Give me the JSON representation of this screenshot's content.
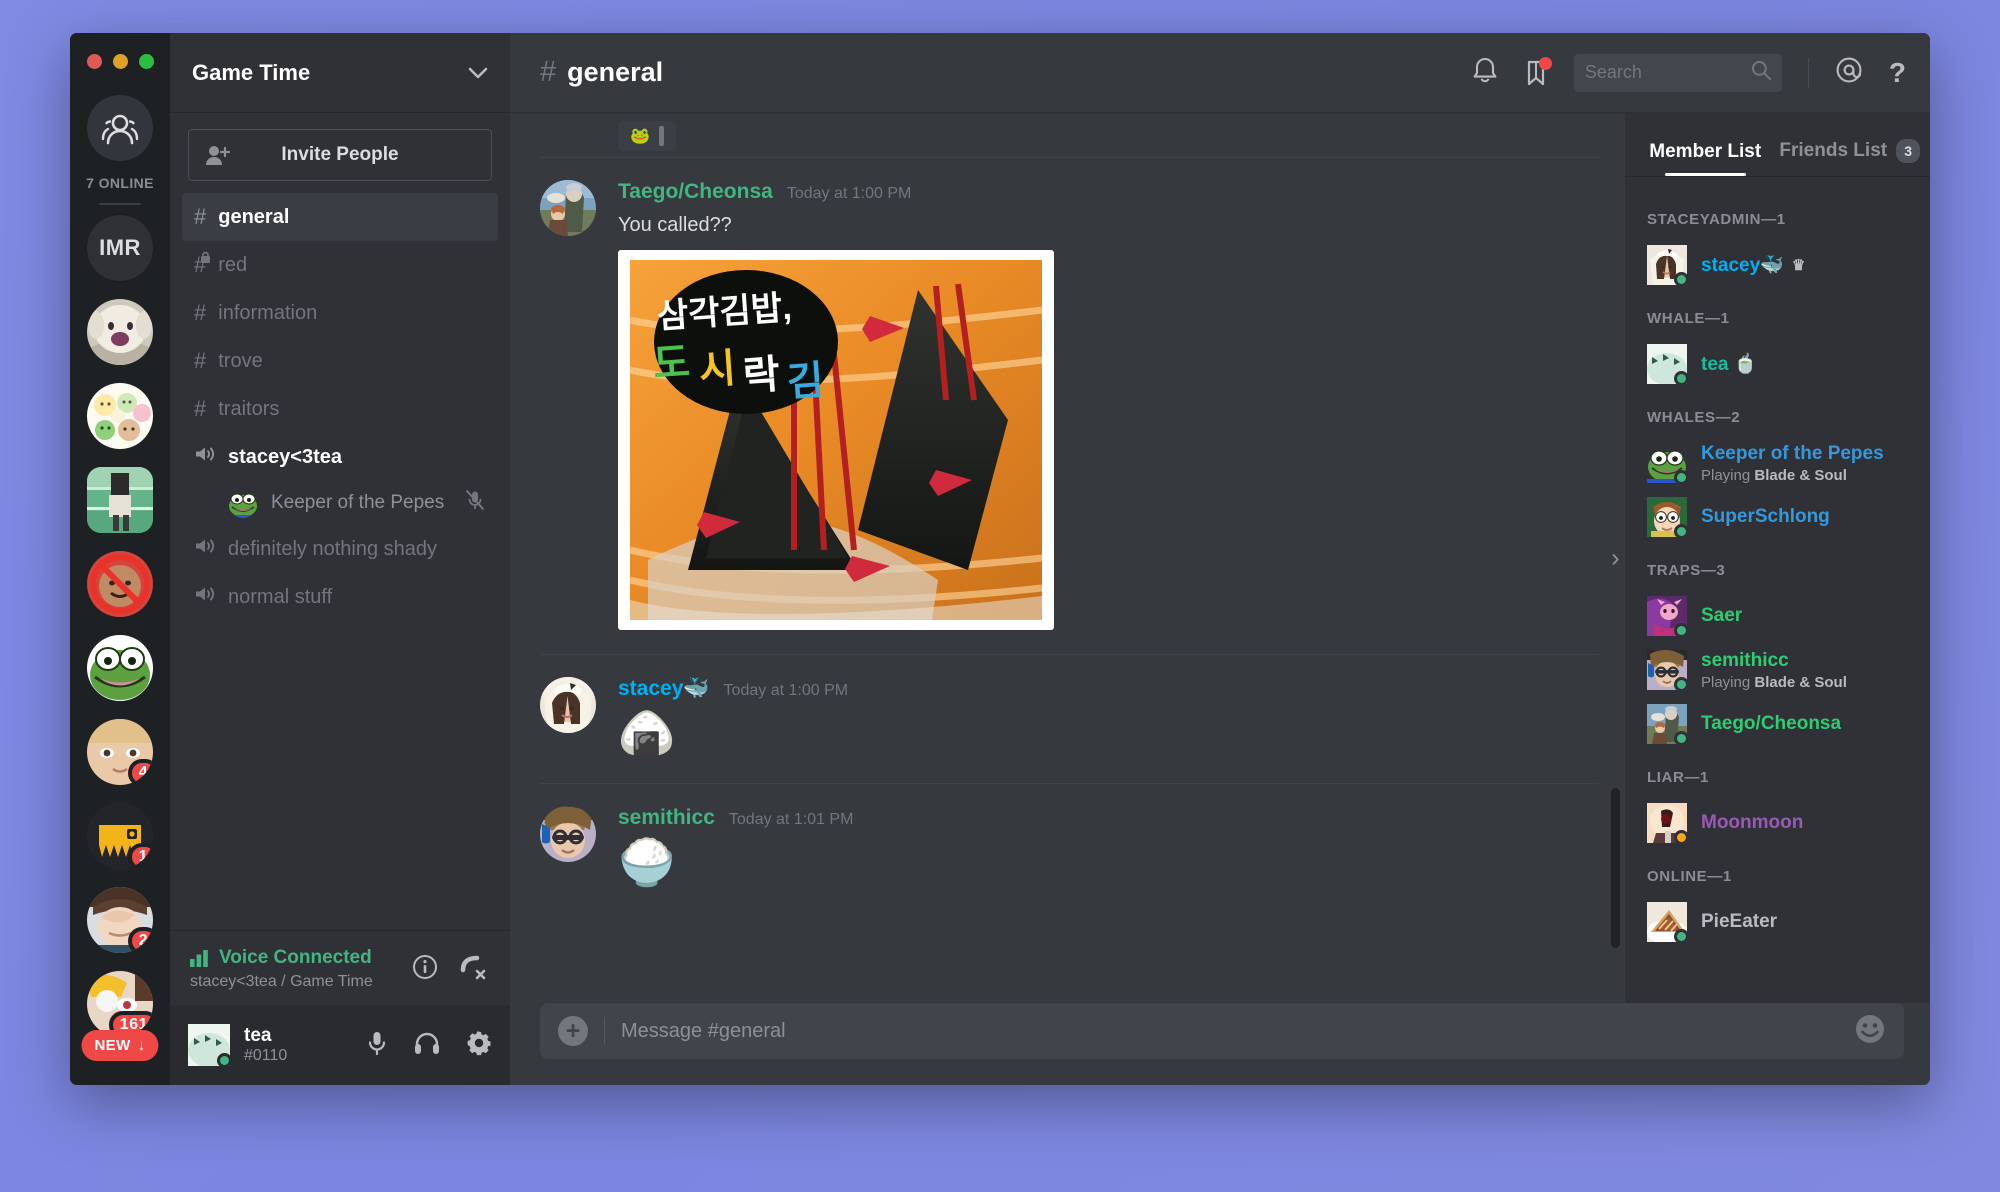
{
  "window": {
    "traffic_lights": [
      "close",
      "minimize",
      "maximize"
    ]
  },
  "rail": {
    "home_icon": "friends-icon",
    "online_label": "7 ONLINE",
    "servers": [
      {
        "name": "IMR",
        "type": "text",
        "badge": null
      },
      {
        "name": "dog-server",
        "type": "art",
        "badge": null
      },
      {
        "name": "stickers-server",
        "type": "art",
        "badge": null
      },
      {
        "name": "track-server",
        "type": "art",
        "badge": null,
        "selected": true
      },
      {
        "name": "noface-server",
        "type": "art",
        "badge": null
      },
      {
        "name": "pepe-server",
        "type": "art",
        "badge": null
      },
      {
        "name": "anime-girl-server",
        "type": "art",
        "badge": "4"
      },
      {
        "name": "yellow-monster-server",
        "type": "art",
        "badge": "1"
      },
      {
        "name": "facepalm-server",
        "type": "art",
        "badge": "2"
      },
      {
        "name": "dva-server",
        "type": "art",
        "badge": "161"
      }
    ],
    "new_pill": "NEW"
  },
  "sidebar": {
    "server_name": "Game Time",
    "invite_label": "Invite People",
    "channels": [
      {
        "name": "general",
        "type": "text",
        "active": true,
        "locked": false
      },
      {
        "name": "red",
        "type": "text",
        "active": false,
        "locked": true
      },
      {
        "name": "information",
        "type": "text",
        "active": false,
        "locked": false
      },
      {
        "name": "trove",
        "type": "text",
        "active": false,
        "locked": false
      },
      {
        "name": "traitors",
        "type": "text",
        "active": false,
        "locked": false
      },
      {
        "name": "stacey<3tea",
        "type": "voice",
        "active": false,
        "locked": false
      },
      {
        "name": "definitely nothing shady",
        "type": "voice",
        "active": false,
        "locked": false
      },
      {
        "name": "normal stuff",
        "type": "voice",
        "active": false,
        "locked": false
      }
    ],
    "voice_members": [
      {
        "name": "Keeper of the Pepes",
        "muted": true
      }
    ],
    "voice_status": {
      "title": "Voice Connected",
      "subtitle": "stacey<3tea / Game Time",
      "title_color": "#43b581",
      "info_icon": "info-icon",
      "disconnect_icon": "phone-hangup-icon"
    },
    "user_panel": {
      "name": "tea",
      "tag": "#0110",
      "mute_icon": "microphone-icon",
      "deafen_icon": "headphones-icon",
      "settings_icon": "gear-icon"
    }
  },
  "header": {
    "channel_name": "general",
    "hash": "#",
    "icons": [
      "bell-icon",
      "pin-icon",
      "mention-icon",
      "help-icon"
    ],
    "pin_has_badge": true
  },
  "search": {
    "placeholder": "Search",
    "value": "",
    "icon": "search-icon"
  },
  "chat": {
    "partial_top_message": {
      "reaction_emoji": "🐸"
    },
    "messages": [
      {
        "author": "Taego/Cheonsa",
        "author_color": "#43b581",
        "timestamp": "Today at 1:00 PM",
        "text": "You called??",
        "attachment": {
          "type": "image",
          "alt": "Korean triangle kimbap (삼각김밥) product photo",
          "caption_text": "삼각김밥, 도시락김"
        },
        "emoji": null
      },
      {
        "author": "stacey🐳",
        "author_color": "#00b0f4",
        "timestamp": "Today at 1:00 PM",
        "text": "",
        "emoji": "🍙",
        "attachment": null
      },
      {
        "author": "semithicc",
        "author_color": "#43b581",
        "timestamp": "Today at 1:01 PM",
        "text": "",
        "emoji": "🍚",
        "attachment": null
      }
    ]
  },
  "composer": {
    "placeholder": "Message #general",
    "add_icon": "plus-icon",
    "emoji_icon": "emoji-icon"
  },
  "member_panel": {
    "tabs": [
      {
        "label": "Member List",
        "active": true,
        "count": null
      },
      {
        "label": "Friends List",
        "active": false,
        "count": "3"
      }
    ],
    "groups": [
      {
        "title": "STACEYADMIN—1",
        "members": [
          {
            "name": "stacey🐳",
            "color": "#00b0f4",
            "status": "online",
            "game": null,
            "crown": true,
            "avatar": "stacey-avatar"
          }
        ]
      },
      {
        "title": "WHALE—1",
        "members": [
          {
            "name": "tea 🍵",
            "color": "#1abc9c",
            "status": "online",
            "game": null,
            "crown": false,
            "avatar": "tea-avatar"
          }
        ]
      },
      {
        "title": "WHALES—2",
        "members": [
          {
            "name": "Keeper of the Pepes",
            "color": "#3498db",
            "status": "online",
            "game": "Blade & Soul",
            "game_prefix": "Playing",
            "crown": false,
            "avatar": "pepe-avatar"
          },
          {
            "name": "SuperSchlong",
            "color": "#3498db",
            "status": "online",
            "game": null,
            "crown": false,
            "avatar": "morty-avatar"
          }
        ]
      },
      {
        "title": "TRAPS—3",
        "members": [
          {
            "name": "Saer",
            "color": "#2ecc71",
            "status": "online",
            "game": null,
            "crown": false,
            "avatar": "saer-avatar"
          },
          {
            "name": "semithicc",
            "color": "#2ecc71",
            "status": "online",
            "game": "Blade & Soul",
            "game_prefix": "Playing",
            "crown": false,
            "avatar": "semithicc-avatar"
          },
          {
            "name": "Taego/Cheonsa",
            "color": "#2ecc71",
            "status": "online",
            "game": null,
            "crown": false,
            "avatar": "taego-avatar"
          }
        ]
      },
      {
        "title": "LIAR—1",
        "members": [
          {
            "name": "Moonmoon",
            "color": "#9b59b6",
            "status": "idle",
            "game": null,
            "crown": false,
            "avatar": "moonmoon-avatar"
          }
        ]
      },
      {
        "title": "ONLINE—1",
        "members": [
          {
            "name": "PieEater",
            "color": "#b9bbbe",
            "status": "online",
            "game": null,
            "crown": false,
            "avatar": "pie-avatar"
          }
        ]
      }
    ],
    "collapse_icon": "chevron-right-icon"
  },
  "colors": {
    "accent_green": "#43b581",
    "accent_blue": "#00b0f4",
    "danger_red": "#f04747",
    "idle_yellow": "#faa61a",
    "bg_main": "#36393e",
    "bg_sidebar": "#2f3136",
    "bg_rail": "#1e2124"
  }
}
